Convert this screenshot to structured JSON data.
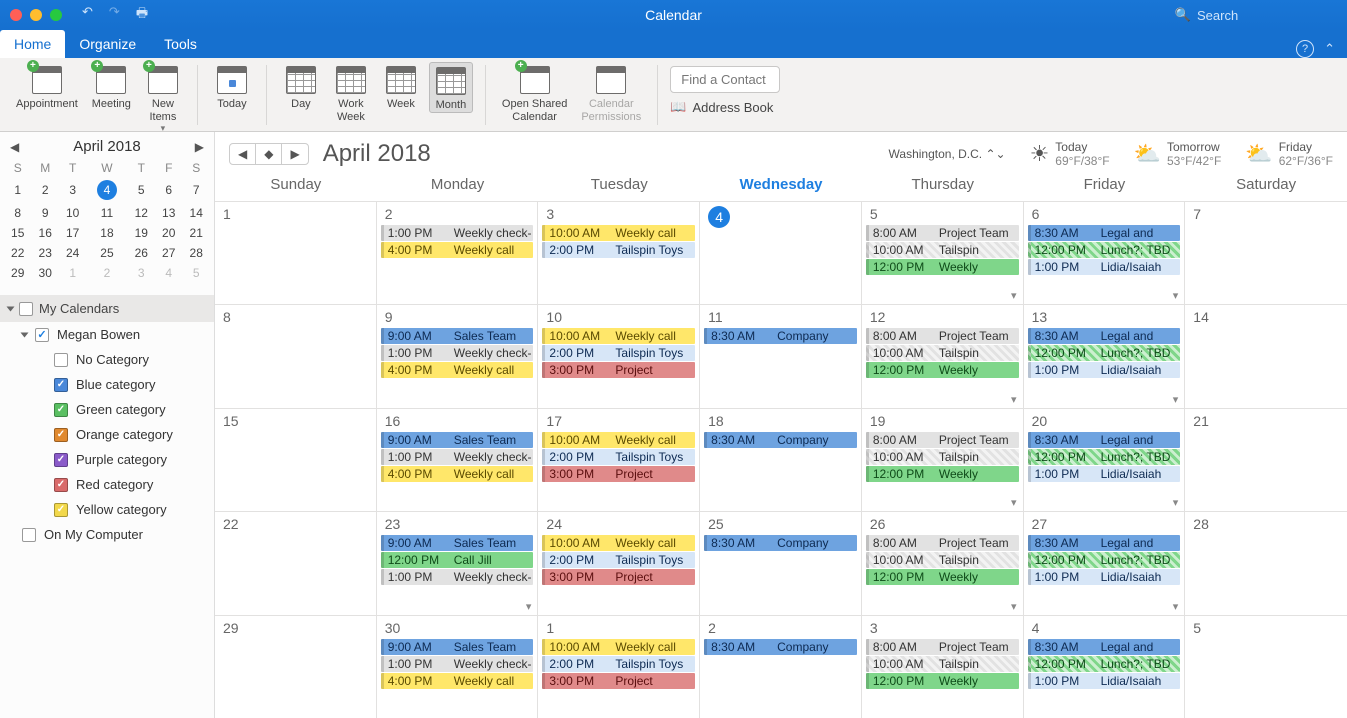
{
  "titlebar": {
    "title": "Calendar",
    "search_placeholder": "Search"
  },
  "tabs": {
    "items": [
      "Home",
      "Organize",
      "Tools"
    ],
    "active": 0
  },
  "ribbon": {
    "new": [
      "Appointment",
      "Meeting",
      "New\nItems"
    ],
    "today": "Today",
    "views": [
      "Day",
      "Work\nWeek",
      "Week",
      "Month"
    ],
    "active_view": 3,
    "share": [
      "Open Shared\nCalendar",
      "Calendar\nPermissions"
    ],
    "find_contact_placeholder": "Find a Contact",
    "address_book": "Address Book"
  },
  "minical": {
    "title": "April 2018",
    "dow": [
      "S",
      "M",
      "T",
      "W",
      "T",
      "F",
      "S"
    ],
    "weeks": [
      [
        {
          "d": 1
        },
        {
          "d": 2
        },
        {
          "d": 3
        },
        {
          "d": 4,
          "today": true
        },
        {
          "d": 5
        },
        {
          "d": 6
        },
        {
          "d": 7
        }
      ],
      [
        {
          "d": 8
        },
        {
          "d": 9
        },
        {
          "d": 10
        },
        {
          "d": 11
        },
        {
          "d": 12
        },
        {
          "d": 13
        },
        {
          "d": 14
        }
      ],
      [
        {
          "d": 15
        },
        {
          "d": 16
        },
        {
          "d": 17
        },
        {
          "d": 18
        },
        {
          "d": 19
        },
        {
          "d": 20
        },
        {
          "d": 21
        }
      ],
      [
        {
          "d": 22
        },
        {
          "d": 23
        },
        {
          "d": 24
        },
        {
          "d": 25
        },
        {
          "d": 26
        },
        {
          "d": 27
        },
        {
          "d": 28
        }
      ],
      [
        {
          "d": 29
        },
        {
          "d": 30
        },
        {
          "d": 1,
          "other": true
        },
        {
          "d": 2,
          "other": true
        },
        {
          "d": 3,
          "other": true
        },
        {
          "d": 4,
          "other": true
        },
        {
          "d": 5,
          "other": true
        }
      ]
    ]
  },
  "sidebar": {
    "group_label": "My Calendars",
    "account": "Megan Bowen",
    "categories": [
      {
        "label": "No Category",
        "color": "#fff",
        "checked": false,
        "border": "#999"
      },
      {
        "label": "Blue category",
        "color": "#4a88d9",
        "checked": true
      },
      {
        "label": "Green category",
        "color": "#5abf62",
        "checked": true
      },
      {
        "label": "Orange category",
        "color": "#e0892f",
        "checked": true
      },
      {
        "label": "Purple category",
        "color": "#8a5bc9",
        "checked": true
      },
      {
        "label": "Red category",
        "color": "#d96a6a",
        "checked": true
      },
      {
        "label": "Yellow category",
        "color": "#f2d84b",
        "checked": true
      }
    ],
    "on_my_computer": "On My Computer"
  },
  "calview": {
    "month_title": "April 2018",
    "location": "Washington,  D.C.",
    "weather": [
      {
        "label": "Today",
        "temps": "69°F/38°F",
        "icon": "☀"
      },
      {
        "label": "Tomorrow",
        "temps": "53°F/42°F",
        "icon": "⛅"
      },
      {
        "label": "Friday",
        "temps": "62°F/36°F",
        "icon": "⛅"
      }
    ],
    "day_names": [
      "Sunday",
      "Monday",
      "Tuesday",
      "Wednesday",
      "Thursday",
      "Friday",
      "Saturday"
    ],
    "today_index": 3,
    "cells": [
      {
        "num": "1"
      },
      {
        "num": "2",
        "events": [
          {
            "t": "1:00 PM",
            "s": "Weekly check-",
            "c": "gray"
          },
          {
            "t": "4:00 PM",
            "s": "Weekly call",
            "c": "yellow"
          }
        ]
      },
      {
        "num": "3",
        "events": [
          {
            "t": "10:00 AM",
            "s": "Weekly call",
            "c": "yellow"
          },
          {
            "t": "2:00 PM",
            "s": "Tailspin Toys",
            "c": "blue-l"
          }
        ]
      },
      {
        "num": "4",
        "today": true
      },
      {
        "num": "5",
        "more": true,
        "events": [
          {
            "t": "8:00 AM",
            "s": "Project Team",
            "c": "gray"
          },
          {
            "t": "10:00 AM",
            "s": "Tailspin",
            "c": "gray",
            "hatch": true
          },
          {
            "t": "12:00 PM",
            "s": "Weekly",
            "c": "green"
          }
        ]
      },
      {
        "num": "6",
        "more": true,
        "events": [
          {
            "t": "8:30 AM",
            "s": "Legal and",
            "c": "blue"
          },
          {
            "t": "12:00 PM",
            "s": "Lunch?; TBD",
            "c": "green",
            "hatch": true
          },
          {
            "t": "1:00 PM",
            "s": "Lidia/Isaiah",
            "c": "blue-l"
          }
        ]
      },
      {
        "num": "7"
      },
      {
        "num": "8"
      },
      {
        "num": "9",
        "events": [
          {
            "t": "9:00 AM",
            "s": "Sales Team",
            "c": "blue"
          },
          {
            "t": "1:00 PM",
            "s": "Weekly check-",
            "c": "gray"
          },
          {
            "t": "4:00 PM",
            "s": "Weekly call",
            "c": "yellow"
          }
        ]
      },
      {
        "num": "10",
        "events": [
          {
            "t": "10:00 AM",
            "s": "Weekly call",
            "c": "yellow"
          },
          {
            "t": "2:00 PM",
            "s": "Tailspin Toys",
            "c": "blue-l"
          },
          {
            "t": "3:00 PM",
            "s": "Project",
            "c": "red"
          }
        ]
      },
      {
        "num": "11",
        "events": [
          {
            "t": "8:30 AM",
            "s": "Company",
            "c": "blue"
          }
        ]
      },
      {
        "num": "12",
        "more": true,
        "events": [
          {
            "t": "8:00 AM",
            "s": "Project Team",
            "c": "gray"
          },
          {
            "t": "10:00 AM",
            "s": "Tailspin",
            "c": "gray",
            "hatch": true
          },
          {
            "t": "12:00 PM",
            "s": "Weekly",
            "c": "green"
          }
        ]
      },
      {
        "num": "13",
        "more": true,
        "events": [
          {
            "t": "8:30 AM",
            "s": "Legal and",
            "c": "blue"
          },
          {
            "t": "12:00 PM",
            "s": "Lunch?; TBD",
            "c": "green",
            "hatch": true
          },
          {
            "t": "1:00 PM",
            "s": "Lidia/Isaiah",
            "c": "blue-l"
          }
        ]
      },
      {
        "num": "14"
      },
      {
        "num": "15"
      },
      {
        "num": "16",
        "events": [
          {
            "t": "9:00 AM",
            "s": "Sales Team",
            "c": "blue"
          },
          {
            "t": "1:00 PM",
            "s": "Weekly check-",
            "c": "gray"
          },
          {
            "t": "4:00 PM",
            "s": "Weekly call",
            "c": "yellow"
          }
        ]
      },
      {
        "num": "17",
        "events": [
          {
            "t": "10:00 AM",
            "s": "Weekly call",
            "c": "yellow"
          },
          {
            "t": "2:00 PM",
            "s": "Tailspin Toys",
            "c": "blue-l"
          },
          {
            "t": "3:00 PM",
            "s": "Project",
            "c": "red"
          }
        ]
      },
      {
        "num": "18",
        "events": [
          {
            "t": "8:30 AM",
            "s": "Company",
            "c": "blue"
          }
        ]
      },
      {
        "num": "19",
        "more": true,
        "events": [
          {
            "t": "8:00 AM",
            "s": "Project Team",
            "c": "gray"
          },
          {
            "t": "10:00 AM",
            "s": "Tailspin",
            "c": "gray",
            "hatch": true
          },
          {
            "t": "12:00 PM",
            "s": "Weekly",
            "c": "green"
          }
        ]
      },
      {
        "num": "20",
        "more": true,
        "events": [
          {
            "t": "8:30 AM",
            "s": "Legal and",
            "c": "blue"
          },
          {
            "t": "12:00 PM",
            "s": "Lunch?; TBD",
            "c": "green",
            "hatch": true
          },
          {
            "t": "1:00 PM",
            "s": "Lidia/Isaiah",
            "c": "blue-l"
          }
        ]
      },
      {
        "num": "21"
      },
      {
        "num": "22"
      },
      {
        "num": "23",
        "more": true,
        "events": [
          {
            "t": "9:00 AM",
            "s": "Sales Team",
            "c": "blue"
          },
          {
            "t": "12:00 PM",
            "s": "Call Jill",
            "c": "green"
          },
          {
            "t": "1:00 PM",
            "s": "Weekly check-",
            "c": "gray"
          }
        ]
      },
      {
        "num": "24",
        "events": [
          {
            "t": "10:00 AM",
            "s": "Weekly call",
            "c": "yellow"
          },
          {
            "t": "2:00 PM",
            "s": "Tailspin Toys",
            "c": "blue-l"
          },
          {
            "t": "3:00 PM",
            "s": "Project",
            "c": "red"
          }
        ]
      },
      {
        "num": "25",
        "events": [
          {
            "t": "8:30 AM",
            "s": "Company",
            "c": "blue"
          }
        ]
      },
      {
        "num": "26",
        "more": true,
        "events": [
          {
            "t": "8:00 AM",
            "s": "Project Team",
            "c": "gray"
          },
          {
            "t": "10:00 AM",
            "s": "Tailspin",
            "c": "gray",
            "hatch": true
          },
          {
            "t": "12:00 PM",
            "s": "Weekly",
            "c": "green"
          }
        ]
      },
      {
        "num": "27",
        "more": true,
        "events": [
          {
            "t": "8:30 AM",
            "s": "Legal and",
            "c": "blue"
          },
          {
            "t": "12:00 PM",
            "s": "Lunch?; TBD",
            "c": "green",
            "hatch": true
          },
          {
            "t": "1:00 PM",
            "s": "Lidia/Isaiah",
            "c": "blue-l"
          }
        ]
      },
      {
        "num": "28"
      },
      {
        "num": "29"
      },
      {
        "num": "30",
        "events": [
          {
            "t": "9:00 AM",
            "s": "Sales Team",
            "c": "blue"
          },
          {
            "t": "1:00 PM",
            "s": "Weekly check-",
            "c": "gray"
          },
          {
            "t": "4:00 PM",
            "s": "Weekly call",
            "c": "yellow"
          }
        ]
      },
      {
        "num": "1",
        "events": [
          {
            "t": "10:00 AM",
            "s": "Weekly call",
            "c": "yellow"
          },
          {
            "t": "2:00 PM",
            "s": "Tailspin Toys",
            "c": "blue-l"
          },
          {
            "t": "3:00 PM",
            "s": "Project",
            "c": "red"
          }
        ]
      },
      {
        "num": "2",
        "events": [
          {
            "t": "8:30 AM",
            "s": "Company",
            "c": "blue"
          }
        ]
      },
      {
        "num": "3",
        "events": [
          {
            "t": "8:00 AM",
            "s": "Project Team",
            "c": "gray"
          },
          {
            "t": "10:00 AM",
            "s": "Tailspin",
            "c": "gray",
            "hatch": true
          },
          {
            "t": "12:00 PM",
            "s": "Weekly",
            "c": "green"
          }
        ]
      },
      {
        "num": "4",
        "events": [
          {
            "t": "8:30 AM",
            "s": "Legal and",
            "c": "blue"
          },
          {
            "t": "12:00 PM",
            "s": "Lunch?; TBD",
            "c": "green",
            "hatch": true
          },
          {
            "t": "1:00 PM",
            "s": "Lidia/Isaiah",
            "c": "blue-l"
          }
        ]
      },
      {
        "num": "5"
      }
    ]
  }
}
